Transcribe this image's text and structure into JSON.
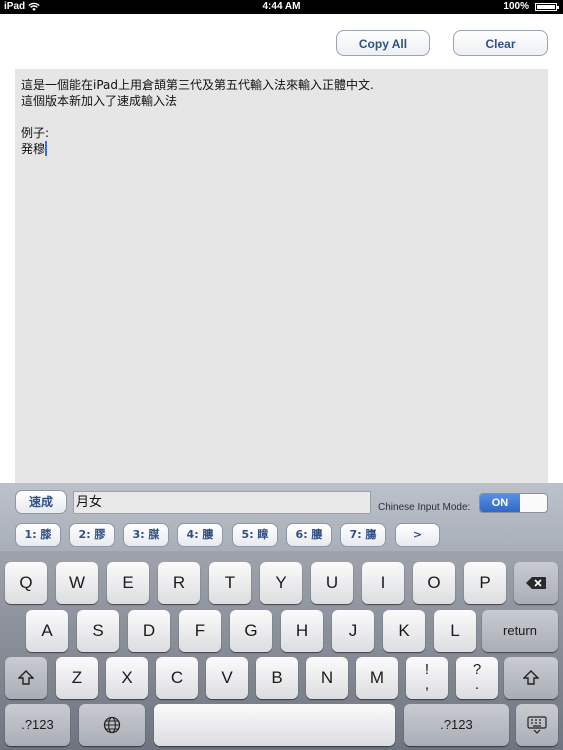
{
  "status_bar": {
    "device": "iPad",
    "time": "4:44 AM",
    "battery_percent": "100%",
    "battery_level": 1.0
  },
  "toolbar": {
    "copy_all_label": "Copy All",
    "clear_label": "Clear"
  },
  "text_area": {
    "lines": [
      "這是一個能在iPad上用倉頡第三代及第五代輸入法來輸入正體中文.",
      "這個版本新加入了速成輸入法",
      "",
      "例子:",
      "発穆"
    ]
  },
  "candidate_bar": {
    "mode_button_label": "速成",
    "input_code": "月女",
    "mode_label": "Chinese Input Mode:",
    "toggle_label": "ON",
    "candidates": [
      "1: 膝",
      "2: 膠",
      "3: 腜",
      "4: 膢",
      "5: 瞕",
      "6: 膢",
      "7: 膓"
    ],
    "more_label": ">"
  },
  "keyboard": {
    "row1": [
      "Q",
      "W",
      "E",
      "R",
      "T",
      "Y",
      "U",
      "I",
      "O",
      "P"
    ],
    "row2": [
      "A",
      "S",
      "D",
      "F",
      "G",
      "H",
      "J",
      "K",
      "L"
    ],
    "return_label": "return",
    "row3": [
      "Z",
      "X",
      "C",
      "V",
      "B",
      "N",
      "M"
    ],
    "punct1_top": "!",
    "punct1_bottom": ",",
    "punct2_top": "?",
    "punct2_bottom": ".",
    "numbers_label": ".?123"
  },
  "colors": {
    "accent": "#324f85",
    "toggle_on": "#2f68c8"
  },
  "icons": {
    "backspace": "backspace-icon",
    "shift": "shift-icon",
    "globe": "globe-icon",
    "hide_keyboard": "hide-keyboard-icon"
  }
}
